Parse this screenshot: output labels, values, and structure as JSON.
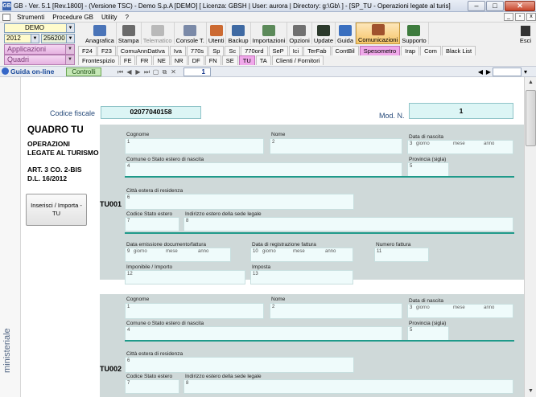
{
  "window": {
    "title": "GB - Ver. 5.1 [Rev.1800] - (Versione TSC) - Demo S.p.A [DEMO]    [ Licenza: GBSH | User: aurora | Directory: g:\\Gb\\ ] - [SP_TU - Operazioni legate al turis]",
    "app_icon": "GB"
  },
  "menu": {
    "items": [
      "Strumenti",
      "Procedure GB",
      "Utility",
      "?"
    ],
    "right_controls": [
      "_",
      "▫",
      "x"
    ]
  },
  "selectors": {
    "company": "DEMO",
    "year": "2012",
    "code": "256200 -",
    "applicazioni": "Applicazioni",
    "quadri": "Quadri"
  },
  "toolbar": {
    "buttons": [
      {
        "label": "Anagrafica",
        "icon": "people-icon",
        "color": "#4a74b8"
      },
      {
        "label": "Stampa",
        "icon": "printer-icon",
        "color": "#6a6a6a"
      },
      {
        "label": "Telematico",
        "icon": "telematico-icon",
        "color": "#b9b9b9",
        "disabled": true
      },
      {
        "label": "Console T.",
        "icon": "console-icon",
        "color": "#7b8aa8"
      },
      {
        "label": "Utenti",
        "icon": "users-icon",
        "color": "#cc6a32"
      },
      {
        "label": "Backup",
        "icon": "backup-icon",
        "color": "#3f6aa3"
      },
      {
        "label": "Importazioni",
        "icon": "import-icon",
        "color": "#5c8a5a"
      },
      {
        "label": "Opzioni",
        "icon": "tools-icon",
        "color": "#707070"
      },
      {
        "label": "Update",
        "icon": "update-icon",
        "color": "#2c3a2c"
      },
      {
        "label": "Guida",
        "icon": "help-icon",
        "color": "#3a6fbf"
      },
      {
        "label": "Comunicazioni",
        "icon": "communications-icon",
        "color": "#a0522d",
        "selected": true
      },
      {
        "label": "Supporto",
        "icon": "support-icon",
        "color": "#3e7c3e"
      }
    ],
    "esci": "Esci"
  },
  "tabs_row1": [
    {
      "label": "F24"
    },
    {
      "label": "F23"
    },
    {
      "label": "ComuAnnDatIva"
    },
    {
      "label": "Iva"
    },
    {
      "label": "770s"
    },
    {
      "label": "Sp"
    },
    {
      "label": "Sc"
    },
    {
      "label": "770ord"
    },
    {
      "label": "SeP"
    },
    {
      "label": "Ici"
    },
    {
      "label": "TerFab"
    },
    {
      "label": "ContBil"
    },
    {
      "label": "Spesometro",
      "active": true
    },
    {
      "label": "Irap"
    },
    {
      "label": "Com"
    },
    {
      "label": "Black List"
    }
  ],
  "tabs_row2": [
    {
      "label": "Frontespizio"
    },
    {
      "label": "FE"
    },
    {
      "label": "FR"
    },
    {
      "label": "NE"
    },
    {
      "label": "NR"
    },
    {
      "label": "DF"
    },
    {
      "label": "FN"
    },
    {
      "label": "SE"
    },
    {
      "label": "TU",
      "active": true
    },
    {
      "label": "TA"
    },
    {
      "label": "Clienti / Fornitori"
    }
  ],
  "guidabar": {
    "guida": "Guida on-line",
    "controlli": "Controlli",
    "page": "1"
  },
  "doc": {
    "codice_fiscale_label": "Codice fiscale",
    "codice_fiscale_value": "02077040158",
    "mod_label": "Mod. N.",
    "mod_value": "1",
    "quadro_title": "QUADRO TU",
    "sub1": "OPERAZIONI",
    "sub2": "LEGATE AL TURISMO",
    "art1": "ART. 3 CO. 2-BIS",
    "art2": "D.L. 16/2012",
    "inserisci": "Inserisci / Importa - TU",
    "side_label": "ministeriale",
    "blocks": [
      {
        "code": "TU001",
        "cognome": "Cognome",
        "nome": "Nome",
        "data_nascita": "Data di nascita",
        "comune": "Comune o Stato estero di nascita",
        "provincia": "Provincia (sigla)",
        "citta": "Città estera di residenza",
        "codice_stato": "Codice Stato estero",
        "indirizzo": "Indirizzo estero della sede legale",
        "data_emissione": "Data emissione documento/fattura",
        "data_registrazione": "Data di registrazione fattura",
        "numero_fattura": "Numero fattura",
        "imponibile": "Imponibile / Importo",
        "imposta": "Imposta"
      },
      {
        "code": "TU002",
        "cognome": "Cognome",
        "nome": "Nome",
        "data_nascita": "Data di nascita",
        "comune": "Comune o Stato estero di nascita",
        "provincia": "Provincia (sigla)",
        "citta": "Città estera di residenza",
        "codice_stato": "Codice Stato estero",
        "indirizzo": "Indirizzo estero della sede legale"
      }
    ],
    "date_parts": {
      "giorno": "giorno",
      "mese": "mese",
      "anno": "anno"
    }
  }
}
